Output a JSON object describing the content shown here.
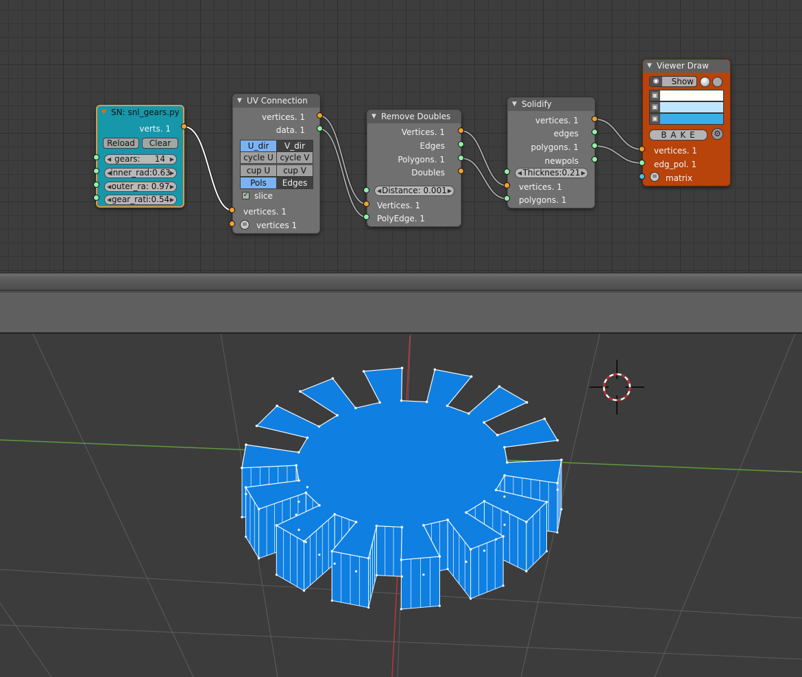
{
  "colors": {
    "node_bg": "#707070",
    "node_header": "#5a5a5a",
    "script_node_bg": "#1797aa",
    "script_node_border": "#e89a3a",
    "viewer_node_bg": "#b8430b",
    "socket_vertices": "#f0a030",
    "socket_generic": "#92f0a8",
    "socket_matrix": "#48c0e8",
    "mesh_fill": "#0f7fe2",
    "toggle_on": "#7ab2f4"
  },
  "nodes": {
    "script": {
      "title": "SN: snl_gears.py",
      "out_label": "verts. 1",
      "reload_label": "Reload",
      "clear_label": "Clear",
      "gears_label": "gears:",
      "gears_value": "14",
      "inner_rad": "inner_rad:0.63",
      "outer_ra": "outer_ra: 0.97",
      "gear_rati": "gear_rati:0.54"
    },
    "uv_connection": {
      "title": "UV Connection",
      "out_vertices": "vertices. 1",
      "out_data": "data. 1",
      "u_dir": "U_dir",
      "v_dir": "V_dir",
      "cycle_u": "cycle U",
      "cycle_v": "cycle V",
      "cup_u": "cup U",
      "cup_v": "cup V",
      "pols": "Pols",
      "edges": "Edges",
      "slice": "slice",
      "in_vertices": "vertices. 1",
      "in_vertices2": "vertices 1"
    },
    "remove_doubles": {
      "title": "Remove Doubles",
      "out_vertices": "Vertices. 1",
      "out_edges": "Edges",
      "out_polygons": "Polygons. 1",
      "out_doubles": "Doubles",
      "distance": "Distance: 0.001",
      "in_vertices": "Vertices. 1",
      "in_polyedge": "PolyEdge. 1"
    },
    "solidify": {
      "title": "Solidify",
      "out_vertices": "vertices. 1",
      "out_edges": "edges",
      "out_polygons": "polygons. 1",
      "out_newpols": "newpols",
      "thickness": "Thicknes:0.21",
      "in_vertices": "vertices. 1",
      "in_polygons": "polygons. 1"
    },
    "viewer_draw": {
      "title": "Viewer Draw",
      "show_label": "Show",
      "bake_label": "B A K E",
      "in_vertices": "vertices. 1",
      "in_edg_pol": "edg_pol. 1",
      "in_matrix": "matrix",
      "swatch_vertex": "#ffffff",
      "swatch_edge": "#bfe6ff",
      "swatch_face": "#3aaeea"
    }
  },
  "viewport": {
    "gear_teeth": 14
  }
}
